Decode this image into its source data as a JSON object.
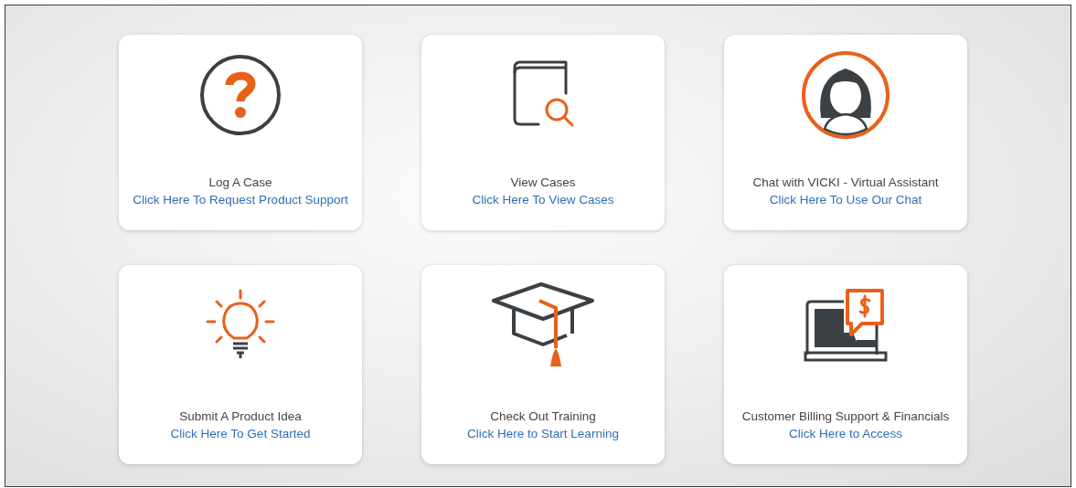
{
  "tiles": [
    {
      "kind": "question",
      "title": "Log A Case",
      "link": "Click Here To Request Product Support"
    },
    {
      "kind": "book-search",
      "title": "View Cases",
      "link": "Click Here To View Cases"
    },
    {
      "kind": "assistant",
      "title": "Chat with VICKI - Virtual Assistant",
      "link": "Click Here To Use Our Chat"
    },
    {
      "kind": "lightbulb",
      "title": "Submit A Product Idea",
      "link": "Click Here To Get Started"
    },
    {
      "kind": "graduation-cap",
      "title": "Check Out Training",
      "link": "Click Here to Start Learning"
    },
    {
      "kind": "billing",
      "title": "Customer Billing Support & Financials",
      "link": "Click Here to Access"
    }
  ]
}
